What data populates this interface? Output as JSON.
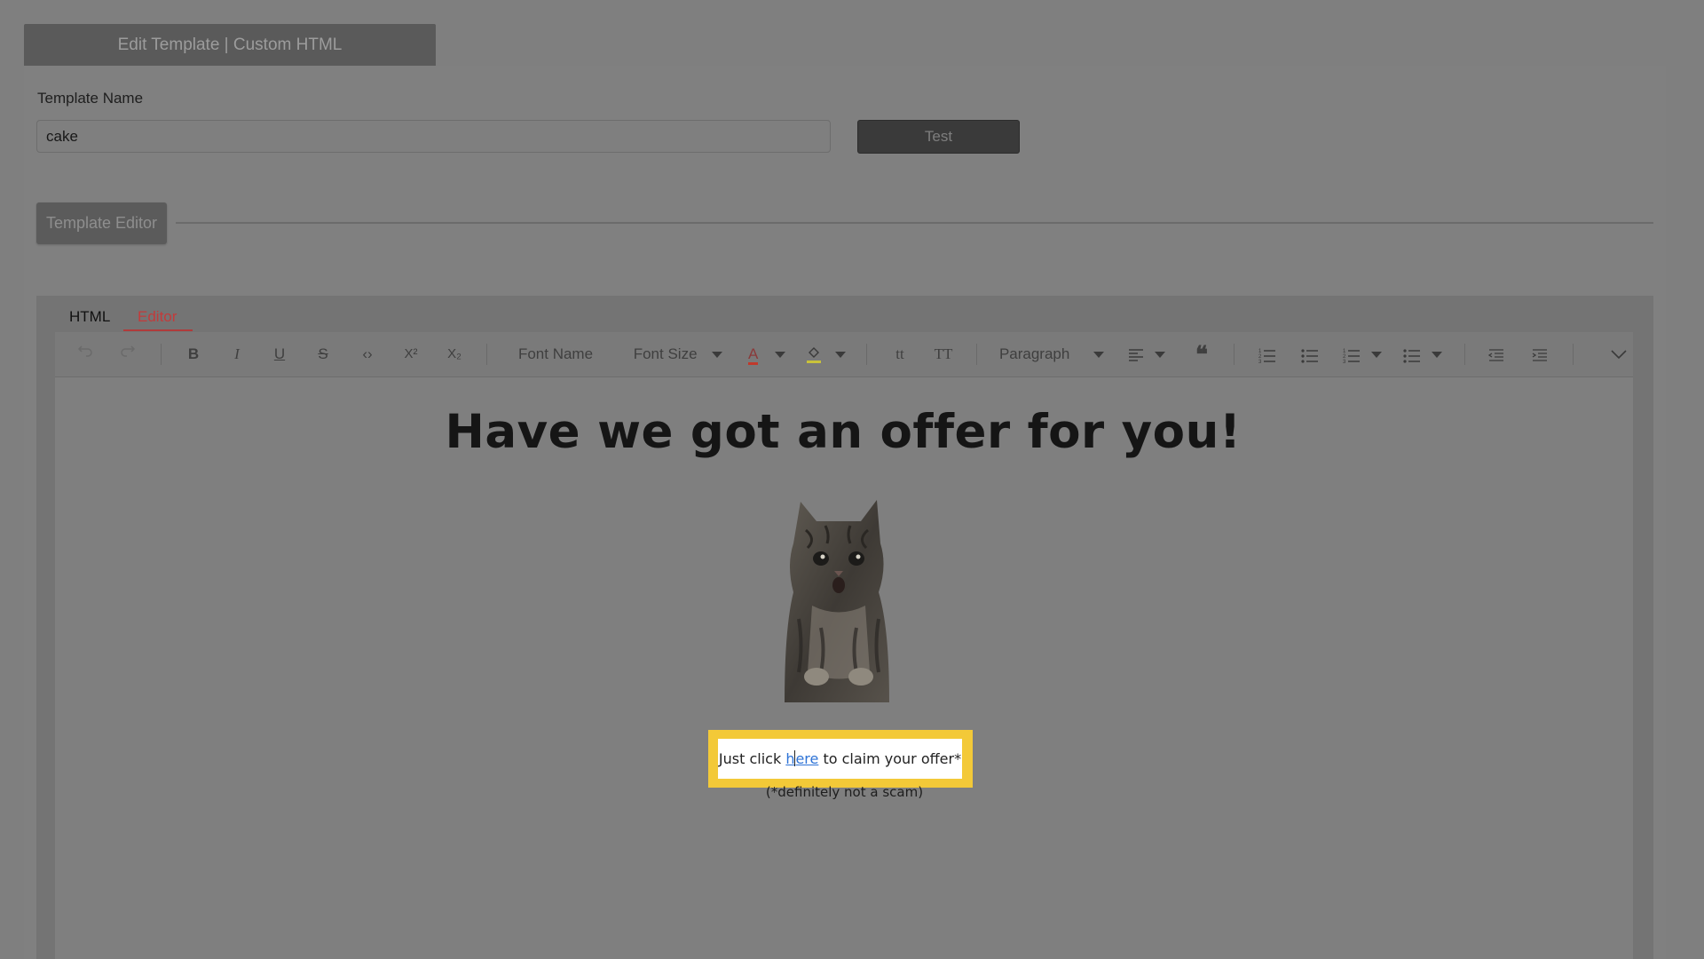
{
  "header": {
    "title": "Edit Template | Custom HTML"
  },
  "form": {
    "template_name_label": "Template Name",
    "template_name_value": "cake",
    "test_button": "Test"
  },
  "section": {
    "template_editor": "Template Editor"
  },
  "tabs": [
    {
      "label": "HTML",
      "active": false
    },
    {
      "label": "Editor",
      "active": true
    }
  ],
  "toolbar": {
    "undo": "undo-icon",
    "redo": "redo-icon",
    "bold": "B",
    "italic": "I",
    "underline": "U",
    "strikethrough": "S",
    "code": "‹›",
    "superscript": "X²",
    "subscript": "X₂",
    "font_name": "Font Name",
    "font_size": "Font Size",
    "font_color": "A",
    "lowercase": "tt",
    "uppercase": "TT",
    "paragraph": "Paragraph",
    "quote": "❝",
    "font_color_hex": "#c0392b",
    "highlight_hex": "#c9c23a"
  },
  "content": {
    "headline": "Have we got an offer for you!",
    "offer_before": "Just click ",
    "offer_link_h": "h",
    "offer_link_rest": "ere",
    "offer_after": " to claim your offer*",
    "disclaimer": "(*definitely not a scam)",
    "image": "cat-photo"
  },
  "colors": {
    "highlight_frame": "#f3c938",
    "active_tab": "#c23b3b",
    "link": "#2e73d6"
  }
}
